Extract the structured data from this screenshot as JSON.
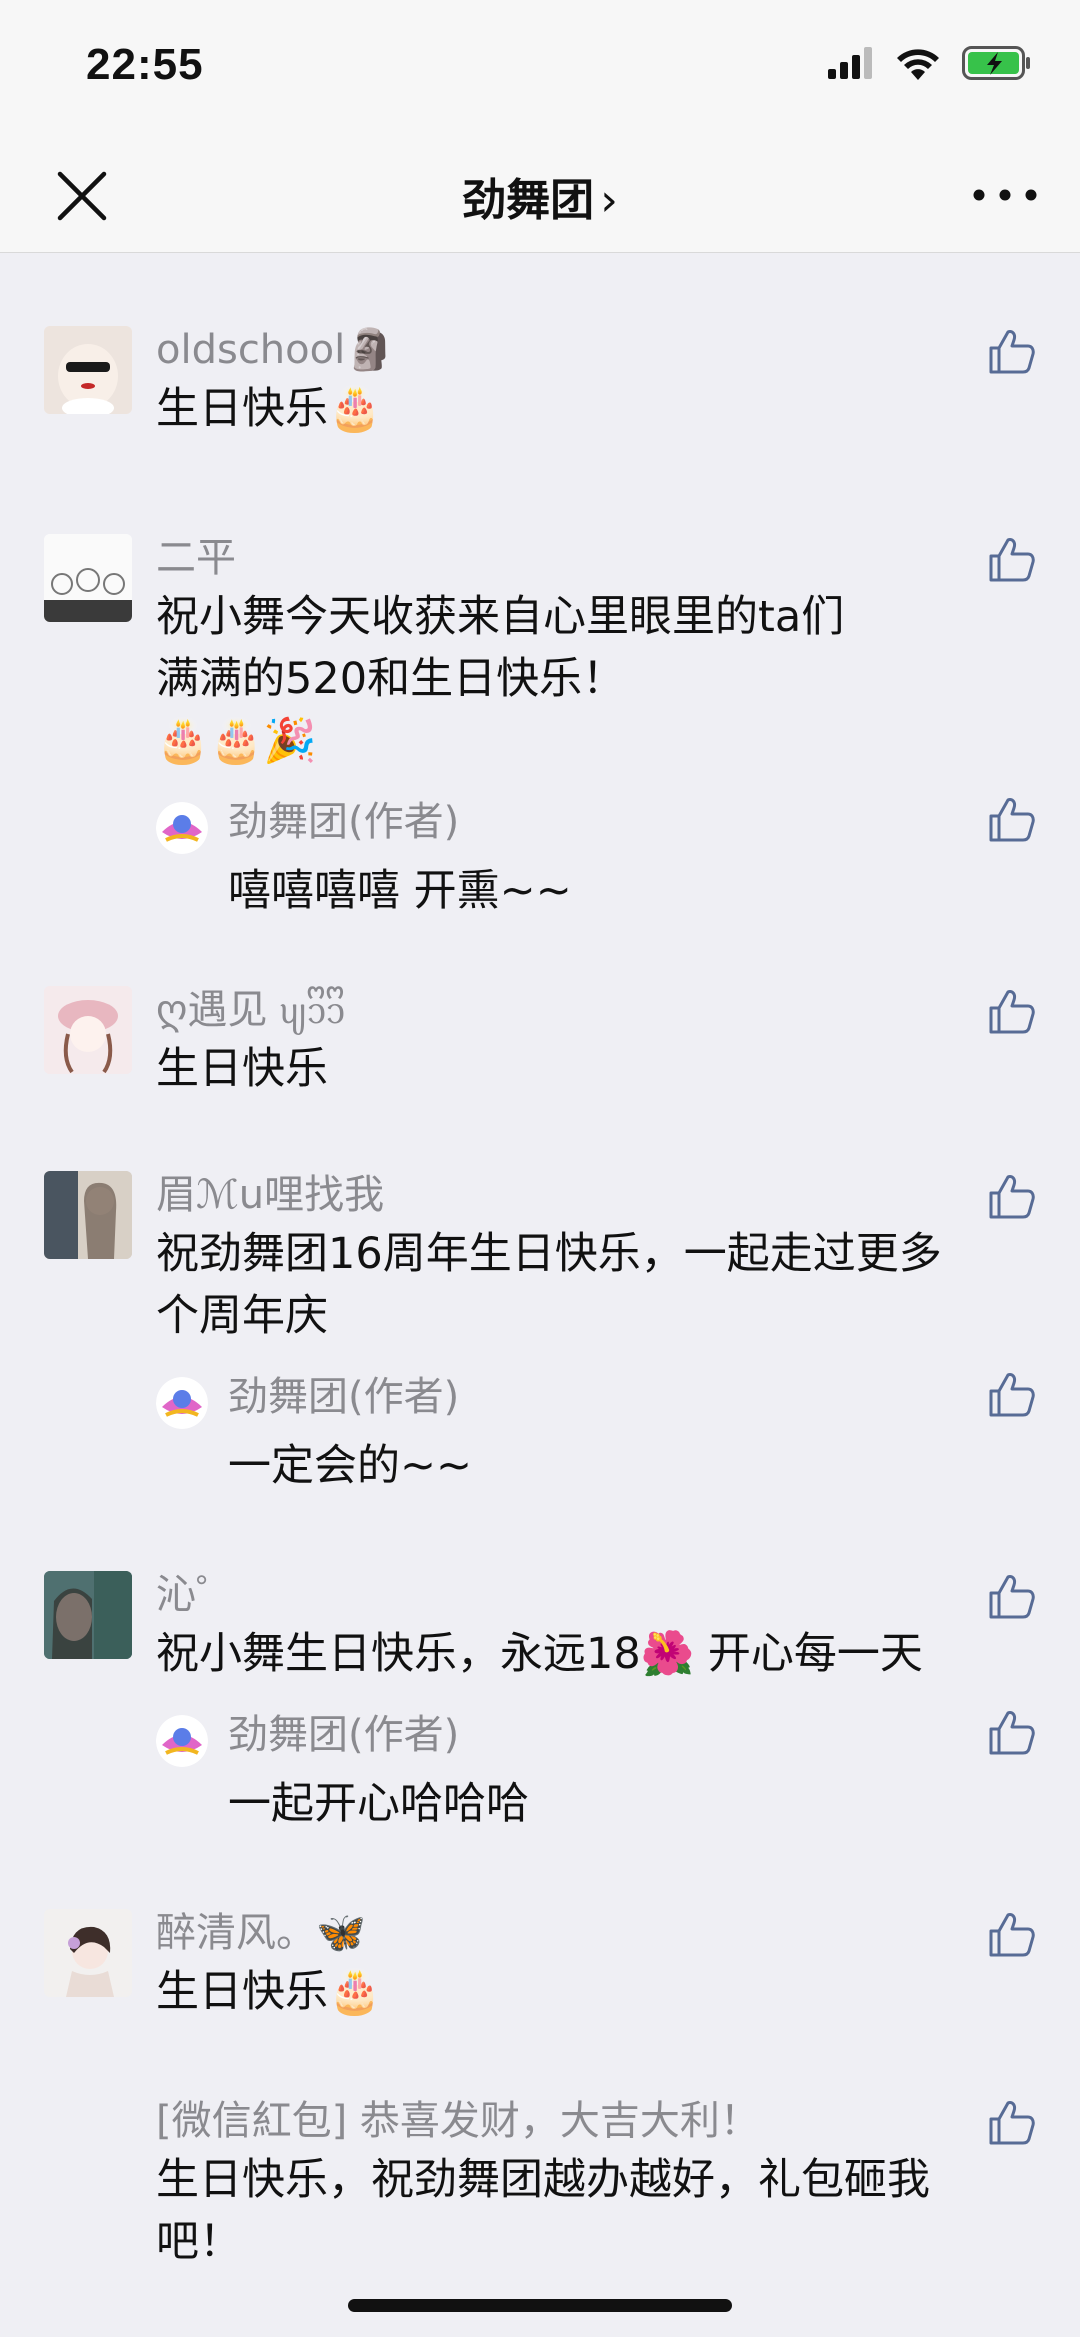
{
  "status_bar": {
    "time": "22:55"
  },
  "nav": {
    "title": "劲舞团",
    "chevron": "›"
  },
  "comments": [
    {
      "nickname": "oldschool🗿",
      "content": "生日快乐🎂"
    },
    {
      "nickname": "二平",
      "content_lines": [
        "祝小舞今天收获来自心里眼里的ta们",
        "满满的520和生日快乐！",
        "🎂🎂🎉"
      ],
      "reply": {
        "nickname": "劲舞团(作者)",
        "content": "嘻嘻嘻嘻 开熏~~"
      }
    },
    {
      "nickname": "ღ遇见 ᦼ᧑ᩚ᧑ᩚ",
      "content": "生日快乐"
    },
    {
      "nickname": "眉ℳu哩找我",
      "content_lines": [
        "祝劲舞团16周年生日快乐，一起走过更多",
        "个周年庆"
      ],
      "reply": {
        "nickname": "劲舞团(作者)",
        "content": "一定会的~~"
      }
    },
    {
      "nickname": "沁゜",
      "content": "祝小舞生日快乐，永远18🌺 开心每一天",
      "reply": {
        "nickname": "劲舞团(作者)",
        "content": "一起开心哈哈哈"
      }
    },
    {
      "nickname": "醉清风。🦋",
      "content": "生日快乐🎂"
    },
    {
      "nickname": "[微信紅包] 恭喜发财，大吉大利！",
      "content_lines": [
        "生日快乐，祝劲舞团越办越好，礼包砸我",
        "吧！"
      ]
    }
  ]
}
